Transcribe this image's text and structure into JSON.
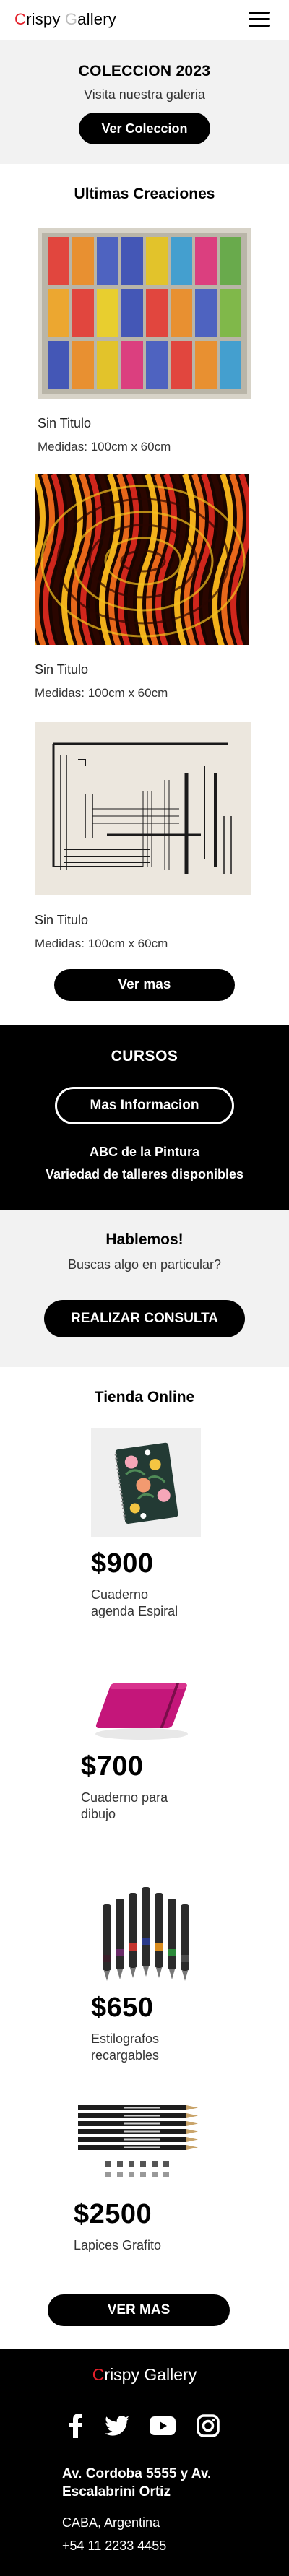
{
  "nav": {
    "brand_first_letter": "C",
    "brand_part1": "rispy ",
    "brand_ghost_letter": "G",
    "brand_part2": "allery"
  },
  "hero": {
    "title": "COLECCION 2023",
    "subtitle": "Visita nuestra galeria",
    "button": "Ver Coleccion"
  },
  "creaciones": {
    "title": "Ultimas Creaciones",
    "items": [
      {
        "title": "Sin Titulo",
        "meta": "Medidas: 100cm x 60cm"
      },
      {
        "title": "Sin Titulo",
        "meta": "Medidas: 100cm x 60cm"
      },
      {
        "title": "Sin Titulo",
        "meta": "Medidas: 100cm x 60cm"
      }
    ],
    "button": "Ver mas"
  },
  "cursos": {
    "title": "CURSOS",
    "button": "Mas Informacion",
    "line1": "ABC de la Pintura",
    "line2": "Variedad de talleres disponibles"
  },
  "hablemos": {
    "title": "Hablemos!",
    "subtitle": "Buscas algo en particular?",
    "button": "REALIZAR CONSULTA"
  },
  "tienda": {
    "title": "Tienda Online",
    "products": [
      {
        "price": "$900",
        "name_line1": "Cuaderno",
        "name_line2": "agenda Espiral"
      },
      {
        "price": "$700",
        "name_line1": "Cuaderno para",
        "name_line2": "dibujo"
      },
      {
        "price": "$650",
        "name_line1": "Estilografos",
        "name_line2": "recargables"
      },
      {
        "price": "$2500",
        "name_line1": "Lapices Grafito",
        "name_line2": ""
      }
    ],
    "button": "VER MAS"
  },
  "footer": {
    "brand_first_letter": "C",
    "brand_rest": "rispy Gallery",
    "social_icons": [
      "facebook-icon",
      "twitter-icon",
      "youtube-icon",
      "instagram-icon"
    ],
    "address_line1": "Av. Cordoba 5555 y Av.",
    "address_line2": "Escalabrini Ortiz",
    "city": "CABA, Argentina",
    "phone": "+54 11 2233 4455"
  },
  "colors": {
    "accent": "#e4202a",
    "dark": "#000000",
    "light_bg": "#f2f2f2"
  }
}
